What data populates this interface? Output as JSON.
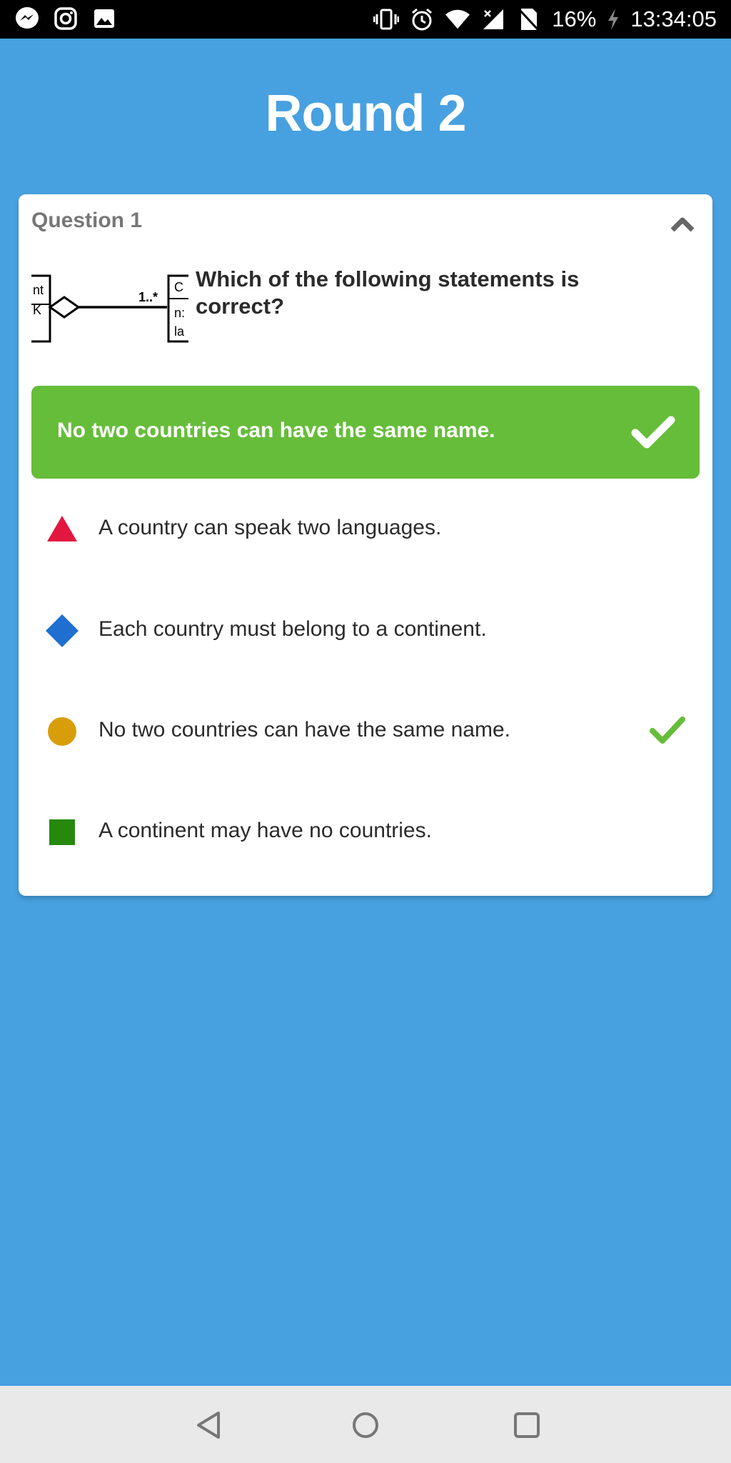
{
  "status_bar": {
    "left_icons": [
      "messenger-icon",
      "instagram-icon",
      "gallery-icon"
    ],
    "right_icons": [
      "vibrate-icon",
      "alarm-icon",
      "wifi-icon",
      "signal-icon",
      "no-sim-icon"
    ],
    "battery_percent": "16%",
    "charging": true,
    "time": "13:34:05"
  },
  "screen": {
    "title": "Round 2"
  },
  "question": {
    "label": "Question 1",
    "text": "Which of the following statements is correct?",
    "diagram": {
      "left_label_top": "nt",
      "left_label_bottom": "K",
      "multiplicity": "1..*",
      "right_label_1": "C",
      "right_label_2": "n:",
      "right_label_3": "la"
    },
    "correct_answer": "No two countries can have the same name.",
    "options": [
      {
        "shape": "triangle",
        "color": "#e2163f",
        "text": "A country can speak two languages.",
        "correct": false
      },
      {
        "shape": "diamond",
        "color": "#1f6fd0",
        "text": "Each country must belong to a continent.",
        "correct": false
      },
      {
        "shape": "circle",
        "color": "#d89e09",
        "text": "No two countries can have the same name.",
        "correct": true
      },
      {
        "shape": "square",
        "color": "#26890c",
        "text": "A continent may have no countries.",
        "correct": false
      }
    ]
  },
  "colors": {
    "background": "#47a0e0",
    "correct_green": "#66bd3a"
  },
  "nav_bar": {
    "buttons": [
      "back-icon",
      "home-icon",
      "recents-icon"
    ]
  }
}
